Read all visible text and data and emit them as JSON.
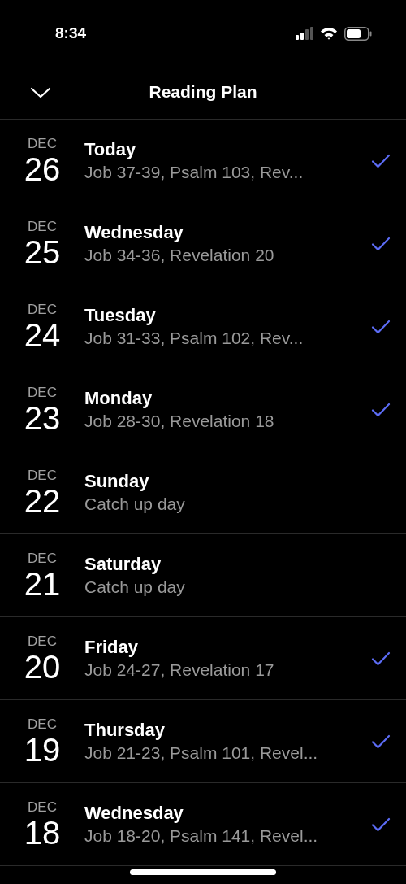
{
  "status_bar": {
    "time": "8:34"
  },
  "header": {
    "title": "Reading Plan"
  },
  "days": [
    {
      "month": "DEC",
      "day": "26",
      "title": "Today",
      "reading": "Job 37-39, Psalm 103, Rev...",
      "checked": true
    },
    {
      "month": "DEC",
      "day": "25",
      "title": "Wednesday",
      "reading": "Job 34-36, Revelation 20",
      "checked": true
    },
    {
      "month": "DEC",
      "day": "24",
      "title": "Tuesday",
      "reading": "Job 31-33, Psalm 102, Rev...",
      "checked": true
    },
    {
      "month": "DEC",
      "day": "23",
      "title": "Monday",
      "reading": "Job 28-30, Revelation 18",
      "checked": true
    },
    {
      "month": "DEC",
      "day": "22",
      "title": "Sunday",
      "reading": "Catch up day",
      "checked": false
    },
    {
      "month": "DEC",
      "day": "21",
      "title": "Saturday",
      "reading": "Catch up day",
      "checked": false
    },
    {
      "month": "DEC",
      "day": "20",
      "title": "Friday",
      "reading": "Job 24-27, Revelation 17",
      "checked": true
    },
    {
      "month": "DEC",
      "day": "19",
      "title": "Thursday",
      "reading": "Job 21-23, Psalm 101, Revel...",
      "checked": true
    },
    {
      "month": "DEC",
      "day": "18",
      "title": "Wednesday",
      "reading": "Job 18-20, Psalm 141, Revel...",
      "checked": true
    }
  ]
}
